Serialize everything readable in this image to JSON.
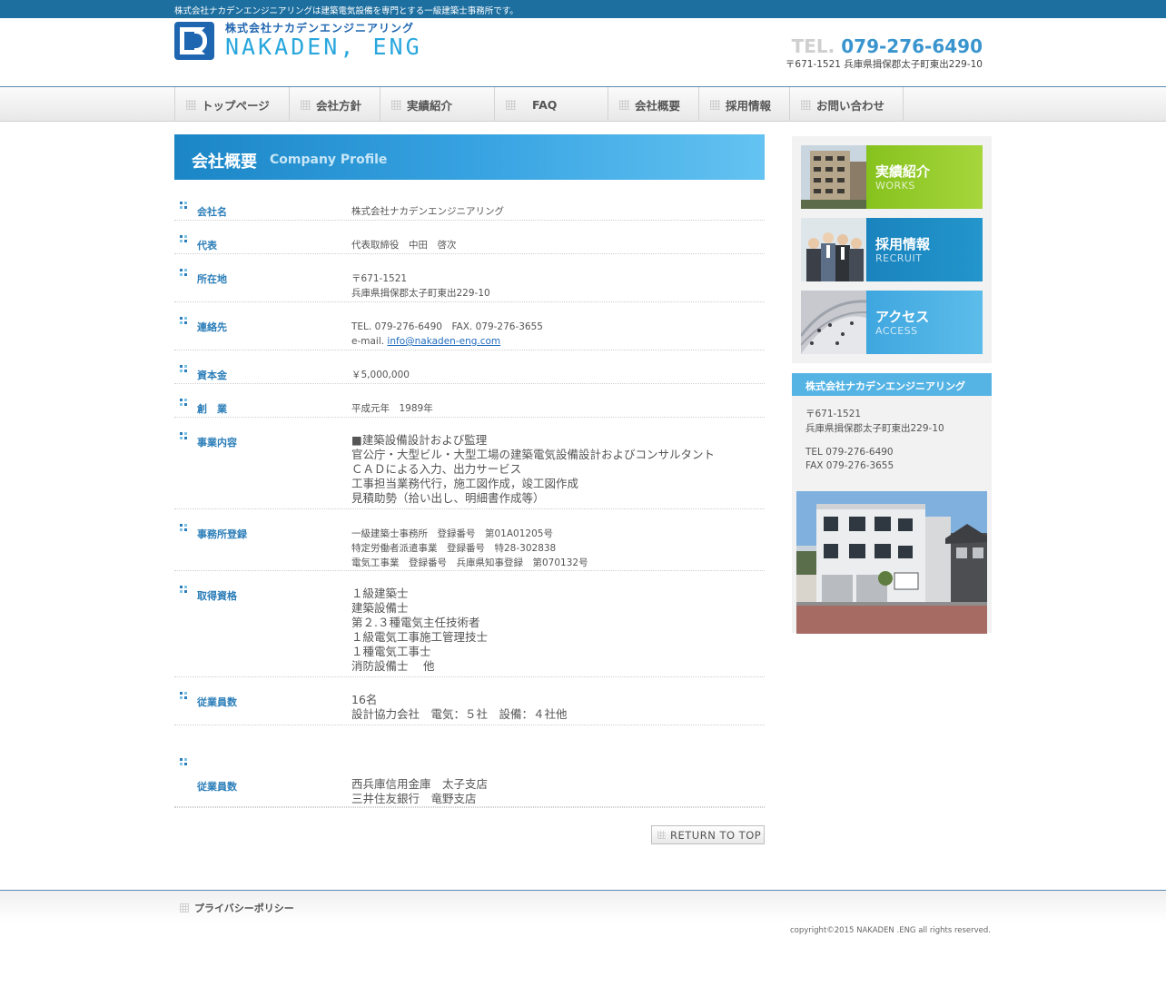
{
  "topbar": {
    "text": "株式会社ナカデンエンジニアリングは建築電気設備を専門とする一級建築士事務所です。"
  },
  "logo": {
    "jp": "株式会社ナカデンエンジニアリング",
    "en": "NAKADEN, ENG"
  },
  "header": {
    "tel_label": "TEL.",
    "tel_number": "079-276-6490",
    "address": "〒671-1521 兵庫県揖保郡太子町東出229-10"
  },
  "nav": [
    "トップページ",
    "会社方針",
    "実績紹介",
    "FAQ",
    "会社概要",
    "採用情報",
    "お問い合わせ"
  ],
  "page_title": {
    "jp": "会社概要",
    "en": "Company Profile"
  },
  "profile": [
    {
      "label": "会社名",
      "lines": [
        "株式会社ナカデンエンジニアリング"
      ]
    },
    {
      "label": "代表",
      "lines": [
        "代表取締役　中田　啓次"
      ]
    },
    {
      "label": "所在地",
      "lines": [
        "〒671-1521",
        "兵庫県揖保郡太子町東出229-10"
      ]
    },
    {
      "label": "連絡先",
      "lines": [
        "TEL. 079-276-6490　FAX. 079-276-3655"
      ],
      "email_prefix": "e-mail. ",
      "email": "info@nakaden-eng.com"
    },
    {
      "label": "資本金",
      "lines": [
        "￥5,000,000"
      ]
    },
    {
      "label": "創　業",
      "lines": [
        "平成元年　1989年"
      ]
    },
    {
      "label": "事業内容",
      "lines": [
        "■建築設備設計および監理",
        "官公庁・大型ビル・大型工場の建築電気設備設計およびコンサルタント",
        "ＣＡＤによる入力、出力サービス",
        "工事担当業務代行，施工図作成，竣工図作成",
        "見積助勢（拾い出し、明細書作成等）"
      ]
    },
    {
      "label": "事務所登録",
      "lines": [
        "一級建築士事務所　登録番号　第01A01205号",
        "特定労働者派遣事業　登録番号　特28-302838",
        "電気工事業　登録番号　兵庫県知事登録　第070132号"
      ]
    },
    {
      "label": "取得資格",
      "lines": [
        "１級建築士",
        "建築設備士",
        "第２.３種電気主任技術者",
        "１級電気工事施工管理技士",
        "１種電気工事士",
        "消防設備士　 他"
      ]
    },
    {
      "label": "従業員数",
      "lines": [
        "16名",
        "設計協力会社　電気：５社　設備：４社他"
      ]
    },
    {
      "label": "従業員数",
      "lines": [
        "西兵庫信用金庫　太子支店",
        "三井住友銀行　竜野支店"
      ]
    }
  ],
  "return_button": "RETURN TO TOP",
  "sidebar": {
    "banners": [
      {
        "jp": "実績紹介",
        "en": "WORKS"
      },
      {
        "jp": "採用情報",
        "en": "RECRUIT"
      },
      {
        "jp": "アクセス",
        "en": "ACCESS"
      }
    ],
    "info_title": "株式会社ナカデンエンジニアリング",
    "postal": "〒671-1521",
    "address": "兵庫県揖保郡太子町東出229-10",
    "tel": "TEL 079-276-6490",
    "fax": "FAX 079-276-3655"
  },
  "footer": {
    "privacy": "プライバシーポリシー",
    "copyright": "copyright©2015 NAKADEN .ENG all rights reserved."
  },
  "colors": {
    "brand": "#1d6fa0",
    "accent": "#3a95cf",
    "label": "#2a7db8"
  }
}
